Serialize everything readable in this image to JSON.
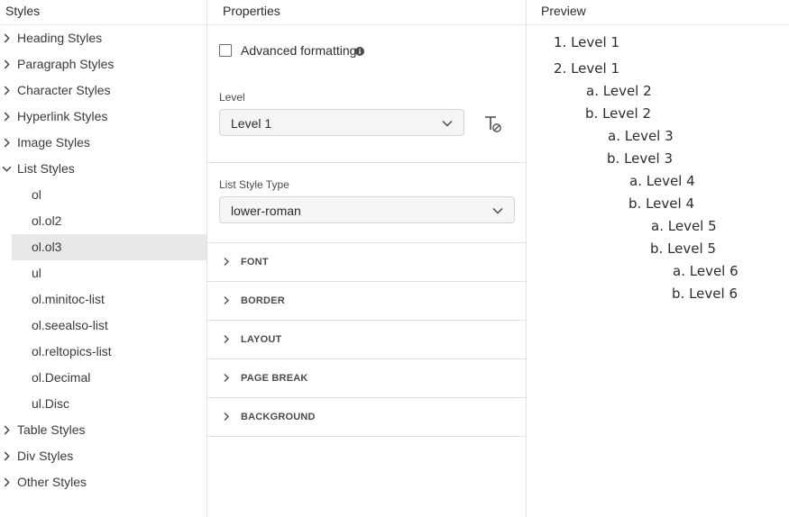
{
  "styles_panel": {
    "title": "Styles",
    "items": [
      {
        "label": "Heading Styles"
      },
      {
        "label": "Paragraph Styles"
      },
      {
        "label": "Character Styles"
      },
      {
        "label": "Hyperlink Styles"
      },
      {
        "label": "Image Styles"
      },
      {
        "label": "List Styles",
        "expanded": true
      },
      {
        "label": "ol"
      },
      {
        "label": "ol.ol2"
      },
      {
        "label": "ol.ol3",
        "selected": true
      },
      {
        "label": "ul"
      },
      {
        "label": "ol.minitoc-list"
      },
      {
        "label": "ol.seealso-list"
      },
      {
        "label": "ol.reltopics-list"
      },
      {
        "label": "ol.Decimal"
      },
      {
        "label": "ul.Disc"
      },
      {
        "label": "Table Styles"
      },
      {
        "label": "Div Styles"
      },
      {
        "label": "Other Styles"
      }
    ]
  },
  "properties_panel": {
    "title": "Properties",
    "advanced_formatting_label": "Advanced formatting",
    "advanced_formatting_checked": false,
    "level_label": "Level",
    "level_value": "Level 1",
    "list_style_type_label": "List Style Type",
    "list_style_type_value": "lower-roman",
    "sections": [
      {
        "label": "FONT"
      },
      {
        "label": "BORDER"
      },
      {
        "label": "LAYOUT"
      },
      {
        "label": "PAGE BREAK"
      },
      {
        "label": "BACKGROUND"
      }
    ]
  },
  "preview_panel": {
    "title": "Preview",
    "items": [
      {
        "marker": "1.",
        "text": "Level 1"
      },
      {
        "marker": "2.",
        "text": "Level 1"
      },
      {
        "marker": "a.",
        "text": "Level 2"
      },
      {
        "marker": "b.",
        "text": "Level 2"
      },
      {
        "marker": "a.",
        "text": "Level 3"
      },
      {
        "marker": "b.",
        "text": "Level 3"
      },
      {
        "marker": "a.",
        "text": "Level 4"
      },
      {
        "marker": "b.",
        "text": "Level 4"
      },
      {
        "marker": "a.",
        "text": "Level 5"
      },
      {
        "marker": "b.",
        "text": "Level 5"
      },
      {
        "marker": "a.",
        "text": "Level 6"
      },
      {
        "marker": "b.",
        "text": "Level 6"
      }
    ]
  },
  "colors": {
    "selected_row": "#e8e8e8",
    "border": "#e1e1e1",
    "text": "#2c2c2c"
  }
}
